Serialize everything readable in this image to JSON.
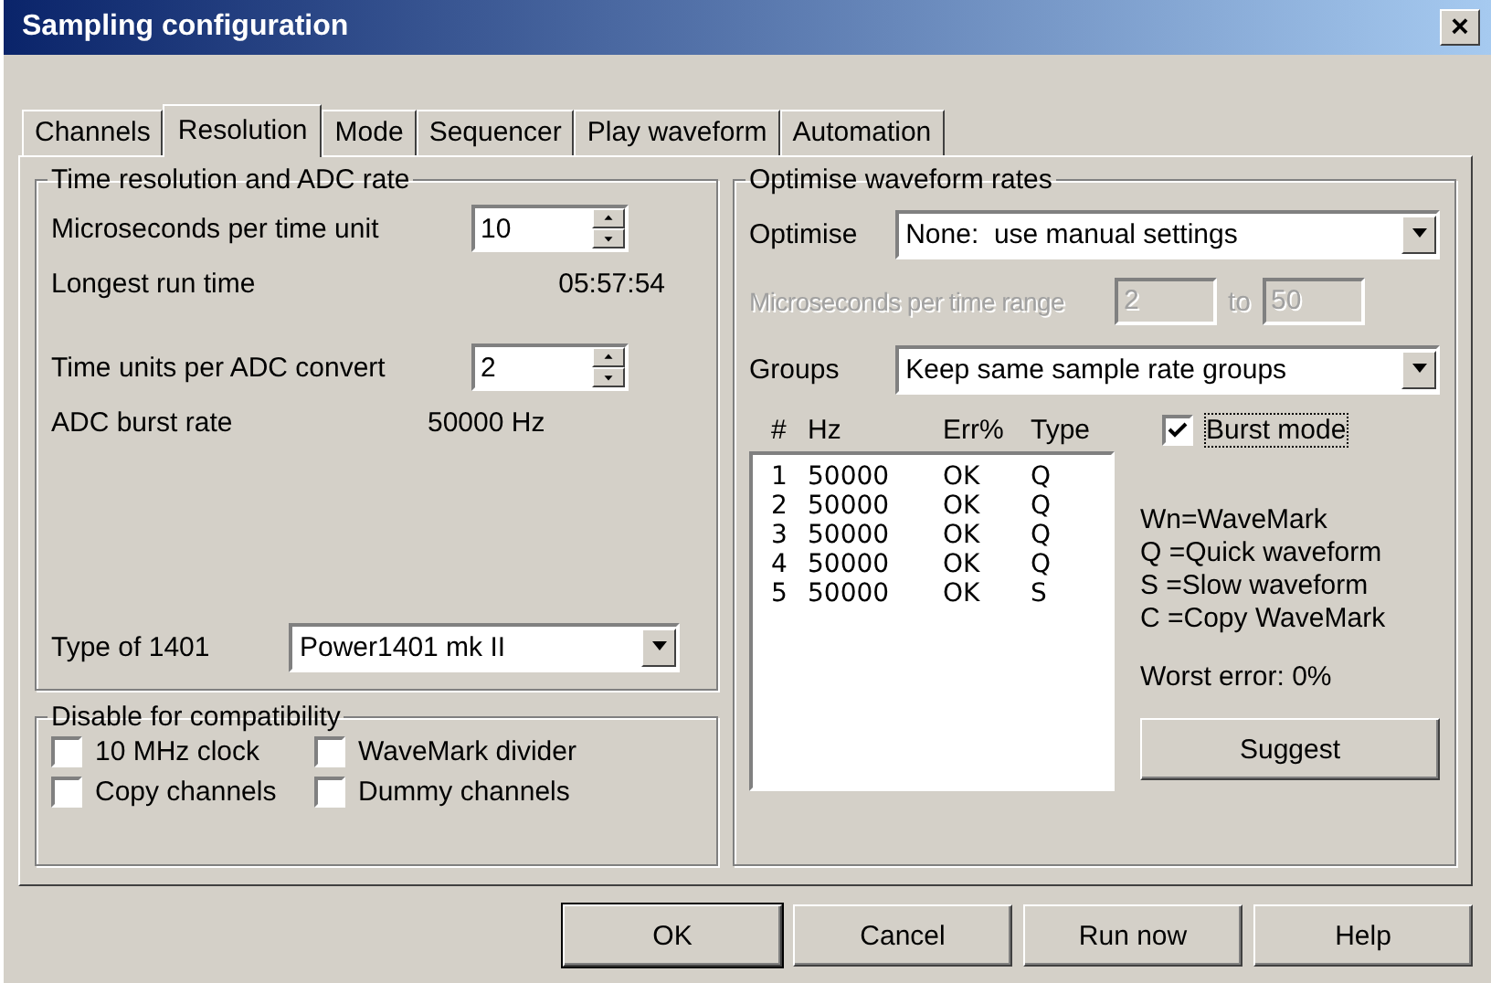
{
  "window": {
    "title": "Sampling configuration",
    "close": "×"
  },
  "tabs": [
    {
      "label": "Channels",
      "selected": false
    },
    {
      "label": "Resolution",
      "selected": true
    },
    {
      "label": "Mode",
      "selected": false
    },
    {
      "label": "Sequencer",
      "selected": false
    },
    {
      "label": "Play waveform",
      "selected": false
    },
    {
      "label": "Automation",
      "selected": false
    }
  ],
  "time_resolution": {
    "title": "Time resolution and ADC rate",
    "microseconds": {
      "label": "Microseconds per time unit",
      "value": "10"
    },
    "longest_run": {
      "label": "Longest run time",
      "value": "05:57:54"
    },
    "time_units": {
      "label": "Time units per ADC convert",
      "value": "2"
    },
    "burst_rate": {
      "label": "ADC burst rate",
      "value": "50000 Hz"
    },
    "type_1401": {
      "label": "Type of 1401",
      "value": "Power1401 mk II"
    }
  },
  "compatibility": {
    "title": "Disable for compatibility",
    "options": [
      {
        "label": "10 MHz clock",
        "checked": false
      },
      {
        "label": "WaveMark divider",
        "checked": false
      },
      {
        "label": "Copy channels",
        "checked": false
      },
      {
        "label": "Dummy channels",
        "checked": false
      }
    ]
  },
  "optimise": {
    "title": "Optimise waveform rates",
    "optimise": {
      "label": "Optimise",
      "value": "None:  use manual settings"
    },
    "range": {
      "label": "Microseconds per time range",
      "from": "2",
      "to_label": "to",
      "to": "50",
      "disabled": true
    },
    "groups": {
      "label": "Groups",
      "value": "Keep same sample rate groups"
    },
    "table": {
      "columns": [
        "#",
        "Hz",
        "Err%",
        "Type"
      ],
      "rows": [
        [
          "1",
          "50000",
          "OK",
          "Q"
        ],
        [
          "2",
          "50000",
          "OK",
          "Q"
        ],
        [
          "3",
          "50000",
          "OK",
          "Q"
        ],
        [
          "4",
          "50000",
          "OK",
          "Q"
        ],
        [
          "5",
          "50000",
          "OK",
          "S"
        ]
      ]
    },
    "burst_mode": {
      "label": "Burst mode",
      "checked": true
    },
    "legend": [
      "Wn=WaveMark",
      "Q =Quick waveform",
      "S =Slow waveform",
      "C =Copy WaveMark"
    ],
    "worst_error": "Worst error: 0%",
    "suggest": "Suggest"
  },
  "buttons": [
    {
      "label": "OK",
      "default": true
    },
    {
      "label": "Cancel",
      "default": false
    },
    {
      "label": "Run now",
      "default": false
    },
    {
      "label": "Help",
      "default": false
    }
  ]
}
